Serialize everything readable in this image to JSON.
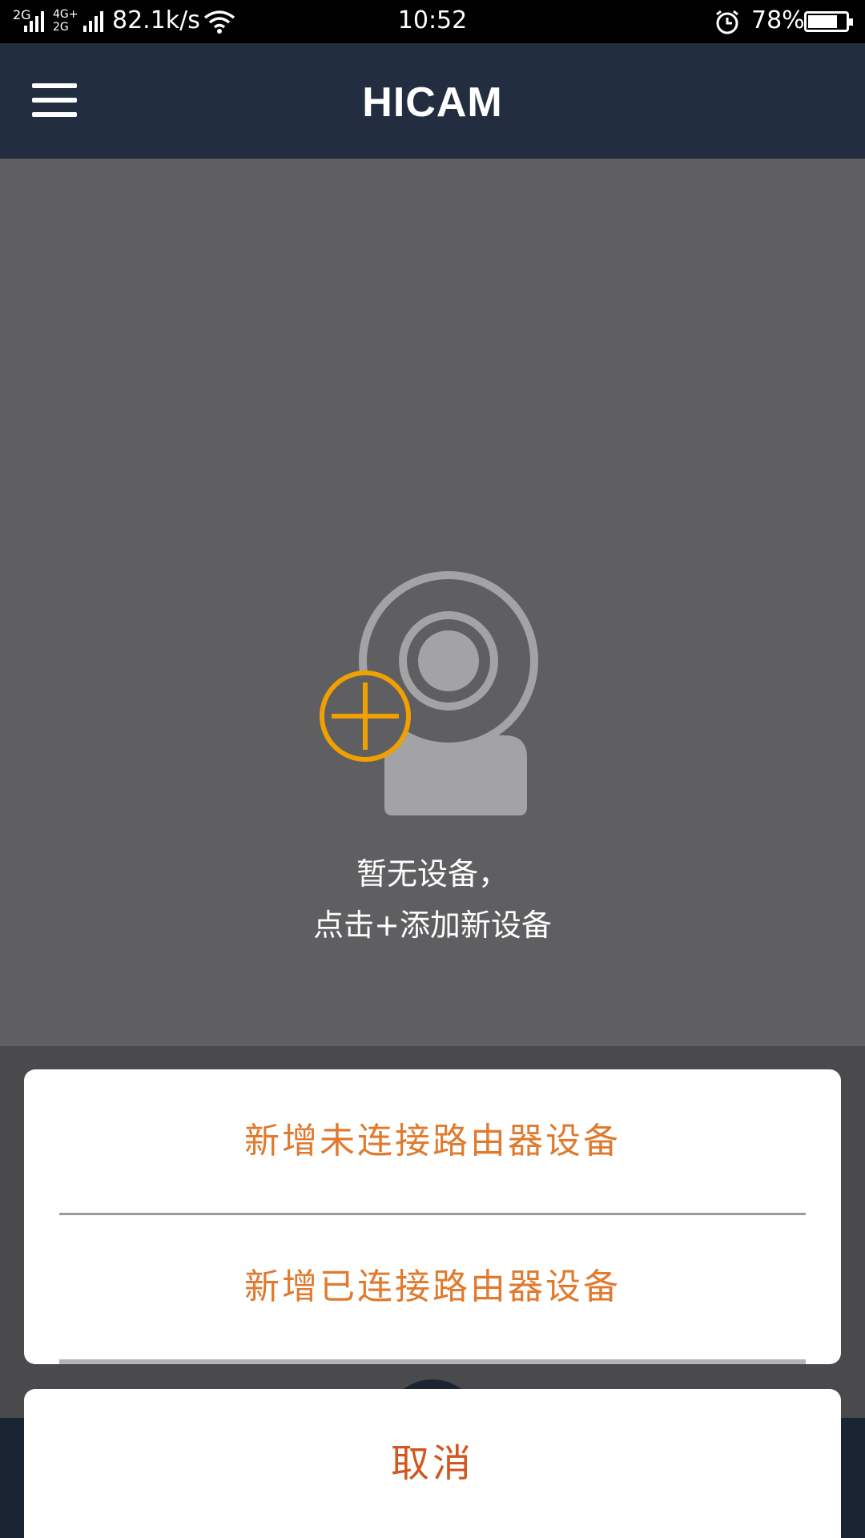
{
  "status_bar": {
    "signal1": "2G",
    "signal2": "4G+ 2G",
    "net_speed": "82.1k/s",
    "time": "10:52",
    "battery_percent": "78%",
    "battery_level": 0.78,
    "icons": [
      "signal-icon",
      "wifi-icon",
      "alarm-icon",
      "battery-icon"
    ]
  },
  "header": {
    "title": "HICAM",
    "menu_icon": "hamburger-menu-icon"
  },
  "empty_state": {
    "line1": "暂无设备，",
    "line2": "点击+添加新设备",
    "illustration_icon": "camera-add-icon",
    "accent_color": "#f0a000"
  },
  "action_sheet": {
    "option1": "新增未连接路由器设备",
    "option2": "新增已连接路由器设备",
    "cancel": "取消",
    "option_color": "#e07a2e",
    "cancel_color": "#d2561f"
  }
}
